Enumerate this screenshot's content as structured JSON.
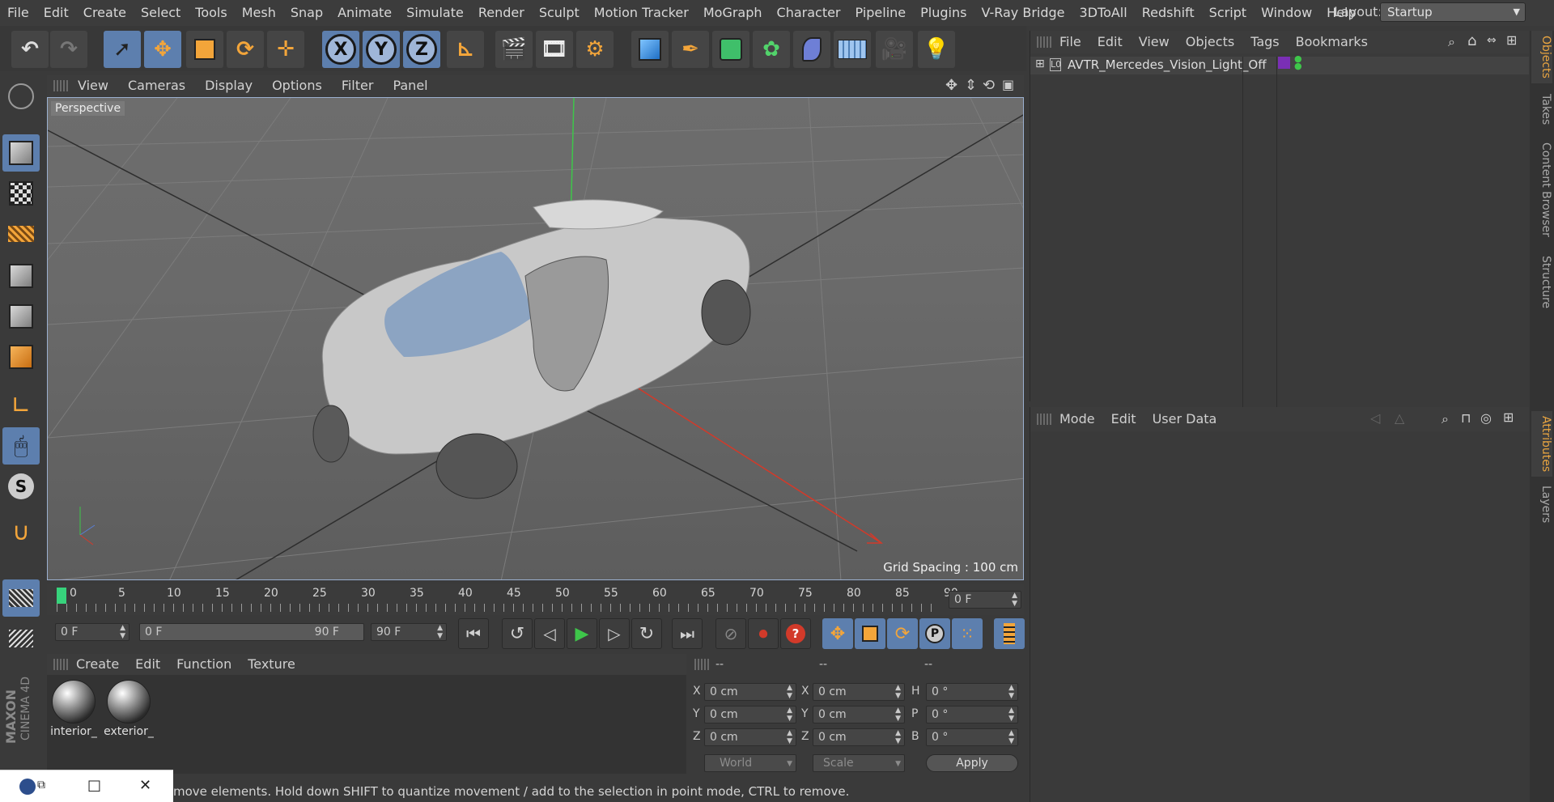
{
  "menu": [
    "File",
    "Edit",
    "Create",
    "Select",
    "Tools",
    "Mesh",
    "Snap",
    "Animate",
    "Simulate",
    "Render",
    "Sculpt",
    "Motion Tracker",
    "MoGraph",
    "Character",
    "Pipeline",
    "Plugins",
    "V-Ray Bridge",
    "3DToAll",
    "Redshift",
    "Script",
    "Window",
    "Help"
  ],
  "layout": {
    "label": "Layout:",
    "value": "Startup"
  },
  "axes": {
    "x": "X",
    "y": "Y",
    "z": "Z"
  },
  "viewport": {
    "menu": [
      "View",
      "Cameras",
      "Display",
      "Options",
      "Filter",
      "Panel"
    ],
    "camera": "Perspective",
    "grid_spacing": "Grid Spacing : 100 cm"
  },
  "timeline": {
    "ticks": [
      "0",
      "5",
      "10",
      "15",
      "20",
      "25",
      "30",
      "35",
      "40",
      "45",
      "50",
      "55",
      "60",
      "65",
      "70",
      "75",
      "80",
      "85",
      "90"
    ],
    "current": "0 F",
    "start": "0 F",
    "range_start": "0 F",
    "range_end": "90 F",
    "end": "90 F"
  },
  "materials": {
    "menu": [
      "Create",
      "Edit",
      "Function",
      "Texture"
    ],
    "items": [
      "interior_",
      "exterior_"
    ]
  },
  "coords": {
    "headers": [
      "--",
      "--",
      "--"
    ],
    "rows": [
      {
        "a": "X",
        "av": "0 cm",
        "b": "X",
        "bv": "0 cm",
        "c": "H",
        "cv": "0 °"
      },
      {
        "a": "Y",
        "av": "0 cm",
        "b": "Y",
        "bv": "0 cm",
        "c": "P",
        "cv": "0 °"
      },
      {
        "a": "Z",
        "av": "0 cm",
        "b": "Z",
        "bv": "0 cm",
        "c": "B",
        "cv": "0 °"
      }
    ],
    "mode": "World",
    "scale": "Scale",
    "apply": "Apply"
  },
  "objects": {
    "menu": [
      "File",
      "Edit",
      "View",
      "Objects",
      "Tags",
      "Bookmarks"
    ],
    "item": "AVTR_Mercedes_Vision_Light_Off"
  },
  "attributes": {
    "menu": [
      "Mode",
      "Edit",
      "User Data"
    ]
  },
  "side_tabs": [
    "Objects",
    "Takes",
    "Content Browser",
    "Structure",
    "Attributes",
    "Layers"
  ],
  "status": "move elements. Hold down SHIFT to quantize movement / add to the selection in point mode, CTRL to remove.",
  "brand": {
    "maxon": "MAXON",
    "product": "CINEMA 4D"
  },
  "taskbar": {
    "minimize": "□",
    "close": "✕"
  }
}
